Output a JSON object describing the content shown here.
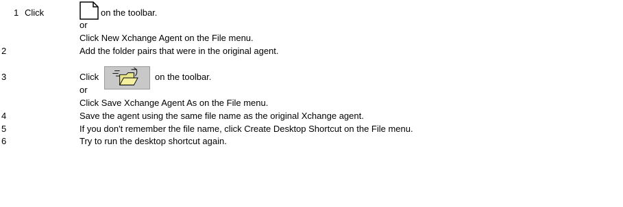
{
  "steps": [
    {
      "number": "1",
      "click_prefix": "Click",
      "after_icon": "on the toolbar.",
      "icon": "new-document-icon",
      "or": "or",
      "alternative": "Click New Xchange Agent on the File menu."
    },
    {
      "number": "2",
      "text": "Add the folder pairs that were in the original agent."
    },
    {
      "number": "3",
      "click_prefix": "Click",
      "after_icon": "on the toolbar.",
      "icon": "open-folder-icon",
      "or": "or",
      "alternative": "Click Save Xchange Agent As on the File menu."
    },
    {
      "number": "4",
      "text": "Save the agent using the same file name as the original Xchange agent."
    },
    {
      "number": "5",
      "text": "If you don't remember the file name, click Create Desktop Shortcut on the File menu."
    },
    {
      "number": "6",
      "text": "Try to run the desktop shortcut again."
    }
  ]
}
